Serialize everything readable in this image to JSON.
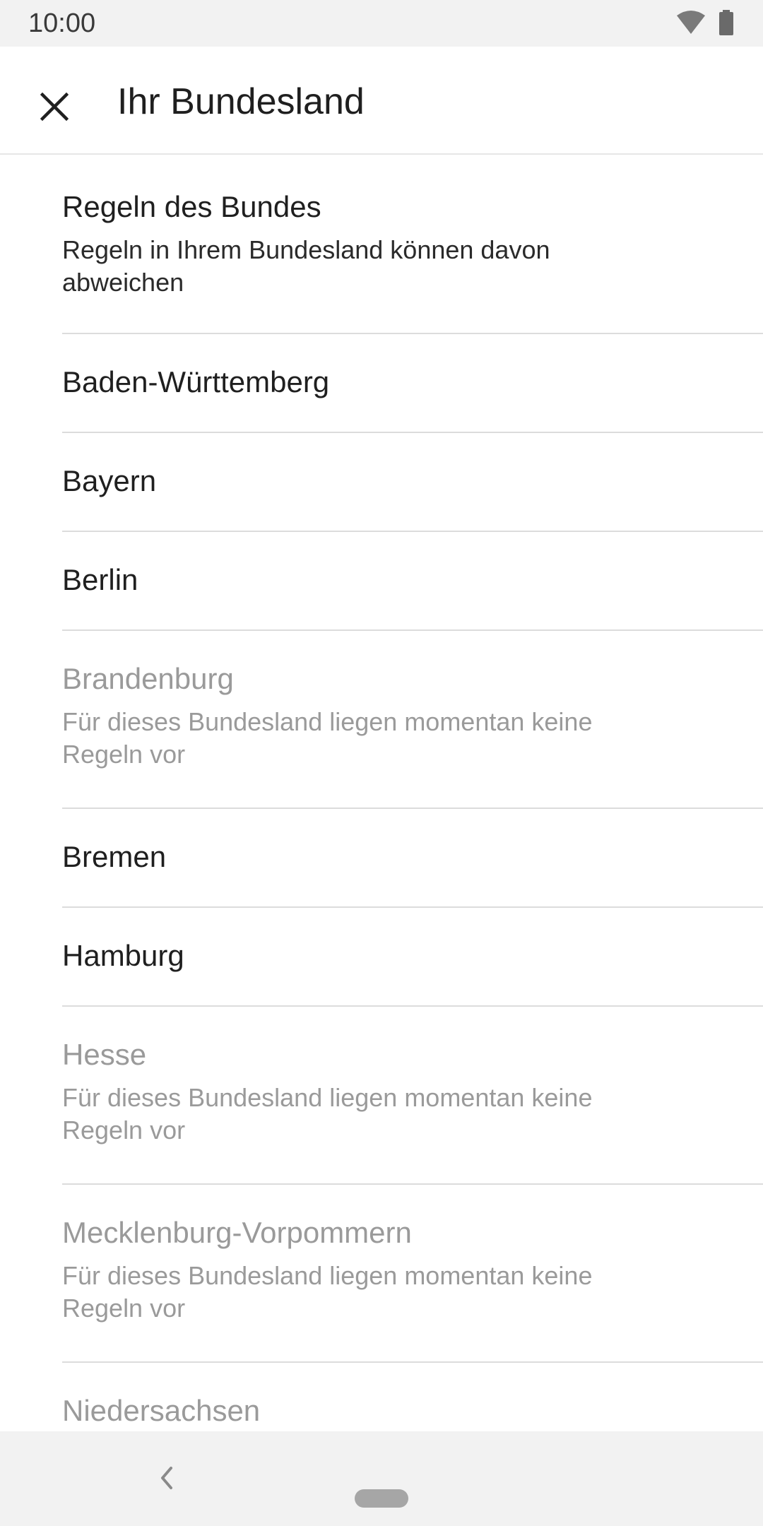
{
  "status": {
    "time": "10:00"
  },
  "appbar": {
    "title": "Ihr Bundesland",
    "close_icon": "close-icon"
  },
  "list": {
    "items": [
      {
        "title": "Regeln des Bundes",
        "subtitle": "Regeln in Ihrem Bundesland können davon abweichen",
        "disabled": false
      },
      {
        "title": "Baden-Württemberg",
        "disabled": false
      },
      {
        "title": "Bayern",
        "disabled": false
      },
      {
        "title": "Berlin",
        "disabled": false
      },
      {
        "title": "Brandenburg",
        "subtitle": "Für dieses Bundesland liegen momentan keine Regeln vor",
        "disabled": true
      },
      {
        "title": "Bremen",
        "disabled": false
      },
      {
        "title": "Hamburg",
        "disabled": false
      },
      {
        "title": "Hesse",
        "subtitle": "Für dieses Bundesland liegen momentan keine Regeln vor",
        "disabled": true
      },
      {
        "title": "Mecklenburg-Vorpommern",
        "subtitle": "Für dieses Bundesland liegen momentan keine Regeln vor",
        "disabled": true
      },
      {
        "title": "Niedersachsen",
        "disabled": true
      }
    ]
  },
  "colors": {
    "primary_text": "#1f1f1f",
    "disabled_text": "#9a9a9a",
    "divider": "#dcdcdc",
    "bars": "#f2f2f2"
  }
}
